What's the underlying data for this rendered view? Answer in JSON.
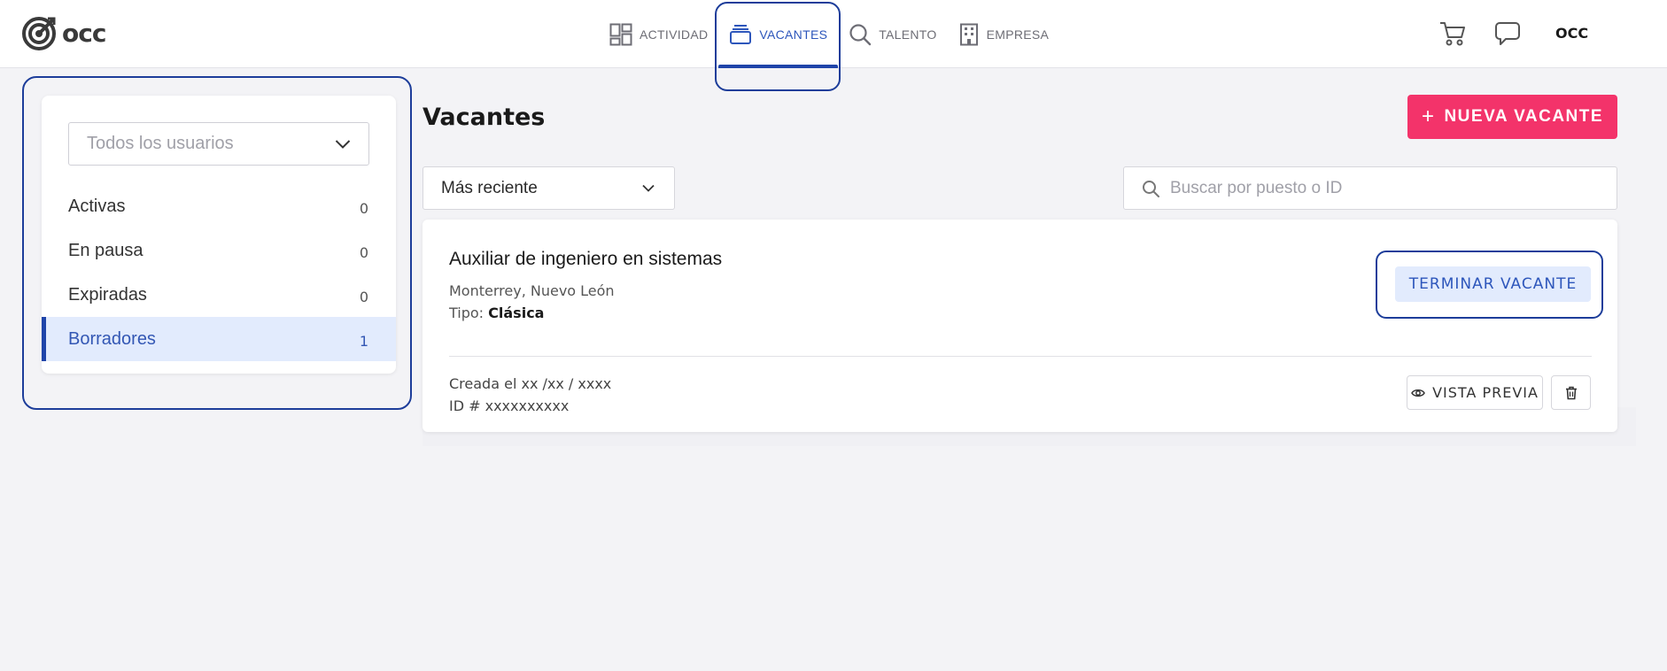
{
  "brand": {
    "logo_text": "occ"
  },
  "nav": {
    "items": [
      {
        "label": "ACTIVIDAD",
        "icon": "dashboard-icon",
        "active": false
      },
      {
        "label": "VACANTES",
        "icon": "stack-icon",
        "active": true
      },
      {
        "label": "TALENTO",
        "icon": "search-icon",
        "active": false
      },
      {
        "label": "EMPRESA",
        "icon": "building-icon",
        "active": false
      }
    ]
  },
  "header": {
    "user_name": "OCC",
    "cart_icon": "cart-icon",
    "chat_icon": "chat-icon"
  },
  "sidebar": {
    "user_filter": {
      "value": "Todos los usuarios"
    },
    "statuses": [
      {
        "label": "Activas",
        "count": "0"
      },
      {
        "label": "En pausa",
        "count": "0"
      },
      {
        "label": "Expiradas",
        "count": "0"
      },
      {
        "label": "Borradores",
        "count": "1",
        "selected": true
      }
    ]
  },
  "main": {
    "title": "Vacantes",
    "new_button": {
      "plus": "+",
      "label": "NUEVA VACANTE"
    },
    "sort": {
      "value": "Más reciente"
    },
    "search": {
      "placeholder": "Buscar por puesto o ID"
    }
  },
  "vacancy": {
    "title": "Auxiliar de ingeniero en sistemas",
    "location": "Monterrey, Nuevo León",
    "type_label": "Tipo:",
    "type_value": "Clásica",
    "end_button": "TERMINAR VACANTE",
    "created": "Creada el xx /xx / xxxx",
    "id": "ID # xxxxxxxxxx",
    "preview_button": "VISTA PREVIA"
  },
  "colors": {
    "accent_blue": "#1f44a9",
    "primary_pink": "#f3336a",
    "selected_bg": "#e2ebfd",
    "page_bg": "#f3f3f6"
  }
}
